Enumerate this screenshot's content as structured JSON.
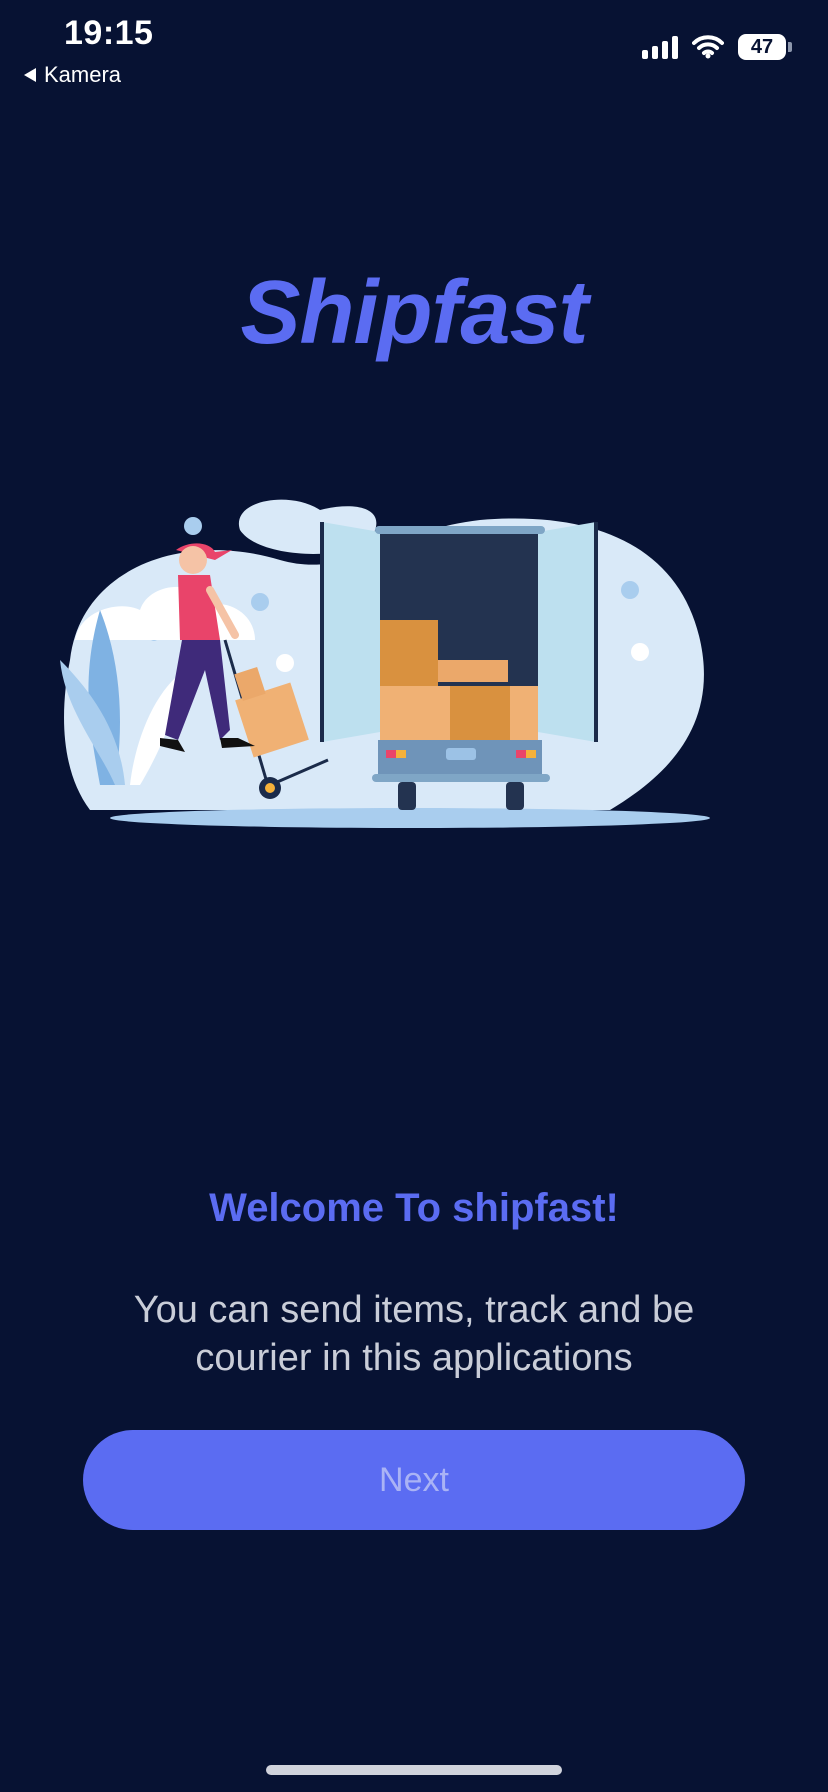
{
  "status_bar": {
    "time": "19:15",
    "back_label": "Kamera",
    "battery_level": "47"
  },
  "app": {
    "logo_text": "Shipfast"
  },
  "onboarding": {
    "welcome_title": "Welcome To shipfast!",
    "description": "You can send items, track and be courier in this applications",
    "next_label": "Next"
  },
  "colors": {
    "background": "#071233",
    "accent": "#5b6cf2",
    "description_text": "#c9cdd8"
  },
  "icons": [
    "back-arrow-icon",
    "cellular-signal-icon",
    "wifi-icon",
    "battery-icon"
  ]
}
